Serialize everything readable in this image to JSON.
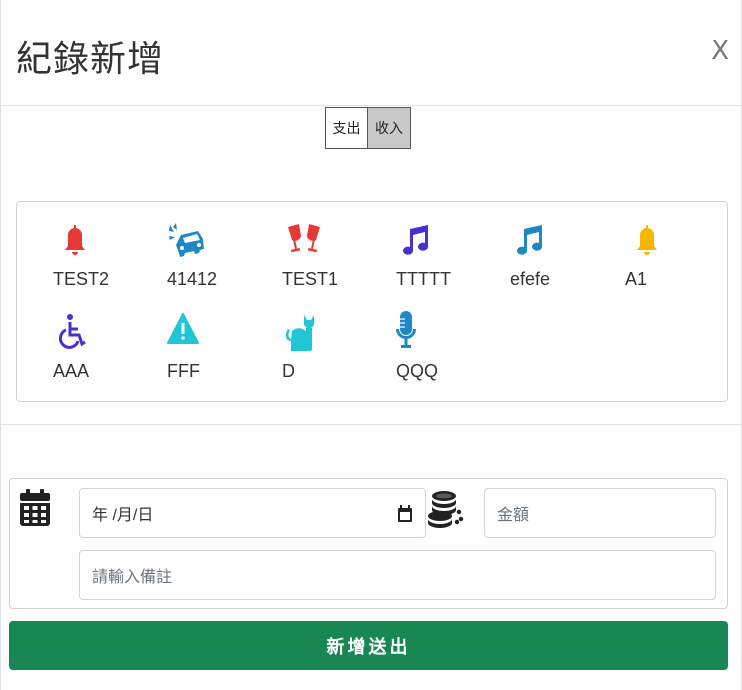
{
  "header": {
    "title": "紀錄新增",
    "close_label": "X"
  },
  "type_toggle": {
    "expense_label": "支出",
    "income_label": "收入",
    "selected": "收入"
  },
  "categories": [
    {
      "label": "TEST2",
      "icon": "bell-icon",
      "color": "#e53935"
    },
    {
      "label": "41412",
      "icon": "car-crash-icon",
      "color": "#1e88c7"
    },
    {
      "label": "TEST1",
      "icon": "wine-glasses-icon",
      "color": "#e53935"
    },
    {
      "label": "TTTTT",
      "icon": "music-note-icon",
      "color": "#4a2fd0"
    },
    {
      "label": "efefe",
      "icon": "music-note-icon",
      "color": "#1e88c7"
    },
    {
      "label": "A1",
      "icon": "bell-icon",
      "color": "#f5b700"
    },
    {
      "label": "AAA",
      "icon": "wheelchair-icon",
      "color": "#4a2fd0"
    },
    {
      "label": "FFF",
      "icon": "warning-triangle-icon",
      "color": "#1fc7d4"
    },
    {
      "label": "D",
      "icon": "cat-icon",
      "color": "#1fc7d4"
    },
    {
      "label": "QQQ",
      "icon": "microphone-icon",
      "color": "#1e88c7"
    }
  ],
  "form": {
    "date_placeholder": "年 /月/日",
    "amount_placeholder": "金額",
    "note_placeholder": "請輸入備註",
    "calendar_icon": "calendar-icon",
    "coins_icon": "coins-icon"
  },
  "submit_label": "新增送出",
  "colors": {
    "submit": "#198754",
    "toggle_active": "#c9c9c9"
  }
}
